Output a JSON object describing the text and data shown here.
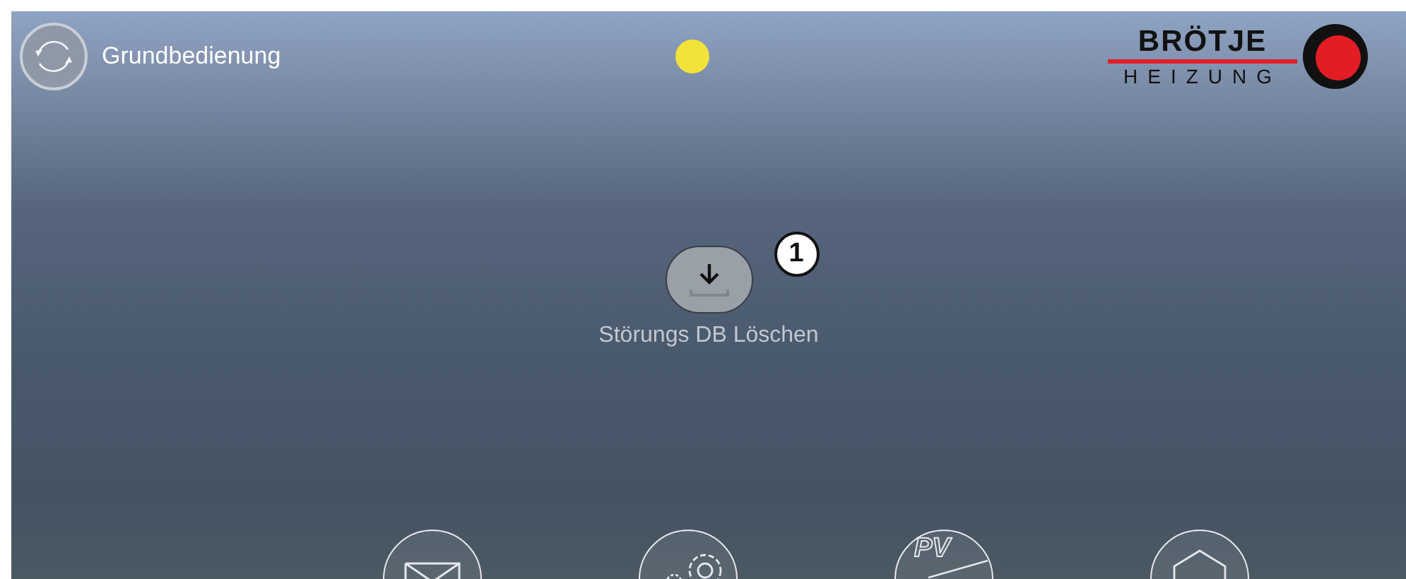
{
  "header": {
    "title": "Grundbedienung",
    "status_dot": {
      "color": "#f2e23a"
    },
    "logo": {
      "line_1": "BRÖTJE",
      "line_2": "HEIZUNG"
    }
  },
  "action": {
    "label": "Störungs DB Löschen",
    "badge": "1"
  },
  "nav": [
    {
      "kind": "mail"
    },
    {
      "kind": "settings"
    },
    {
      "kind": "pv",
      "label": "PV"
    },
    {
      "kind": "home"
    }
  ]
}
